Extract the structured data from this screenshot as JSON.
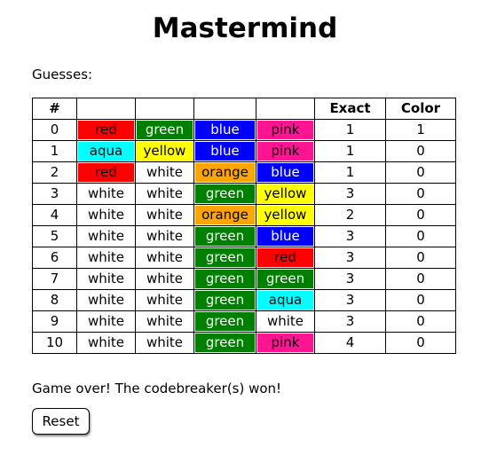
{
  "title": "Mastermind",
  "guesses_label": "Guesses:",
  "table": {
    "headers": [
      "#",
      "",
      "",
      "",
      "",
      "Exact",
      "Color"
    ]
  },
  "colors": {
    "red": "#ff0000",
    "green": "#008000",
    "blue": "#0000ff",
    "pink": "#ff1493",
    "aqua": "#00ffff",
    "yellow": "#ffff00",
    "white": "#ffffff",
    "orange": "#ffa500"
  },
  "text_colors": {
    "red": "#000000",
    "green": "#ffffff",
    "blue": "#ffffff",
    "pink": "#000000",
    "aqua": "#000000",
    "yellow": "#000000",
    "white": "#000000",
    "orange": "#000000"
  },
  "guesses": [
    {
      "num": "0",
      "pegs": [
        "red",
        "green",
        "blue",
        "pink"
      ],
      "exact": "1",
      "color": "1"
    },
    {
      "num": "1",
      "pegs": [
        "aqua",
        "yellow",
        "blue",
        "pink"
      ],
      "exact": "1",
      "color": "0"
    },
    {
      "num": "2",
      "pegs": [
        "red",
        "white",
        "orange",
        "blue"
      ],
      "exact": "1",
      "color": "0"
    },
    {
      "num": "3",
      "pegs": [
        "white",
        "white",
        "green",
        "yellow"
      ],
      "exact": "3",
      "color": "0"
    },
    {
      "num": "4",
      "pegs": [
        "white",
        "white",
        "orange",
        "yellow"
      ],
      "exact": "2",
      "color": "0"
    },
    {
      "num": "5",
      "pegs": [
        "white",
        "white",
        "green",
        "blue"
      ],
      "exact": "3",
      "color": "0"
    },
    {
      "num": "6",
      "pegs": [
        "white",
        "white",
        "green",
        "red"
      ],
      "exact": "3",
      "color": "0"
    },
    {
      "num": "7",
      "pegs": [
        "white",
        "white",
        "green",
        "green"
      ],
      "exact": "3",
      "color": "0"
    },
    {
      "num": "8",
      "pegs": [
        "white",
        "white",
        "green",
        "aqua"
      ],
      "exact": "3",
      "color": "0"
    },
    {
      "num": "9",
      "pegs": [
        "white",
        "white",
        "green",
        "white"
      ],
      "exact": "3",
      "color": "0"
    },
    {
      "num": "10",
      "pegs": [
        "white",
        "white",
        "green",
        "pink"
      ],
      "exact": "4",
      "color": "0"
    }
  ],
  "status": "Game over! The codebreaker(s) won!",
  "reset_label": "Reset"
}
